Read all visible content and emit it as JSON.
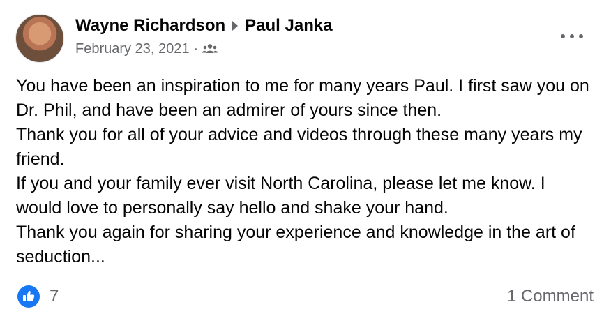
{
  "post": {
    "author": "Wayne Richardson",
    "target": "Paul Janka",
    "date": "February 23, 2021",
    "separator": "·",
    "audience_icon": "friends-icon",
    "menu_icon": "more-options-icon",
    "body_lines": [
      "You have been an inspiration to me for many years Paul. I first saw you on Dr. Phil, and have been an admirer of yours since then.",
      "Thank you for all of your advice and videos through these many years my friend.",
      "If you and your family ever visit North Carolina, please let me know. I would love to personally say hello and shake your hand.",
      "Thank you again for sharing your experience and knowledge in the art of seduction..."
    ]
  },
  "footer": {
    "reaction_icon": "like-icon",
    "reaction_count": "7",
    "comments_label": "1 Comment"
  },
  "colors": {
    "like_blue": "#1877f2",
    "secondary_text": "#65676b",
    "primary_text": "#050505"
  }
}
